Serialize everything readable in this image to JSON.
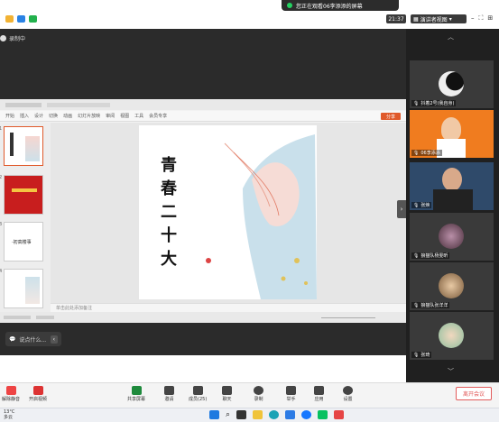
{
  "share_banner": {
    "text": "您正在观看06李添添的屏幕"
  },
  "top": {
    "time": "21:37",
    "speaker_view": "演讲者视图",
    "dropdown_icon": "chevron-down-icon"
  },
  "recording": {
    "label": "录制中"
  },
  "ppt": {
    "menu": [
      "开始",
      "插入",
      "设计",
      "切换",
      "动画",
      "幻灯片放映",
      "审阅",
      "视图",
      "工具",
      "会员专享"
    ],
    "export_label": "分享",
    "notes_placeholder": "单击此处添加备注",
    "slide_chars": [
      "青",
      "春",
      "二",
      "十",
      "大"
    ],
    "thumb_numbers": [
      "1",
      "2",
      "3",
      "4"
    ],
    "thumb3_text": "·初高楼事"
  },
  "participants": [
    {
      "name": "抖着2号(我自身)"
    },
    {
      "name": "06李添添"
    },
    {
      "name": "张焕"
    },
    {
      "name": "狼猫队杨雯昕"
    },
    {
      "name": "狼猫队张洋洋"
    },
    {
      "name": "张琦"
    }
  ],
  "chat": {
    "placeholder": "说点什么..."
  },
  "toolbar": {
    "unmute": "解除静音",
    "video": "开启视频",
    "share": "共享屏幕",
    "invite": "邀请",
    "members": "成员(25)",
    "chat": "聊天",
    "record": "录制",
    "raise_hand": "举手",
    "apps": "应用",
    "settings": "设置",
    "leave": "离开会议"
  },
  "taskbar": {
    "temp": "13°C",
    "weather": "多云"
  },
  "colors": {
    "accent_red": "#e25b5b",
    "ppt_orange": "#e05a2b",
    "bg_dark": "#2b2b2b"
  }
}
